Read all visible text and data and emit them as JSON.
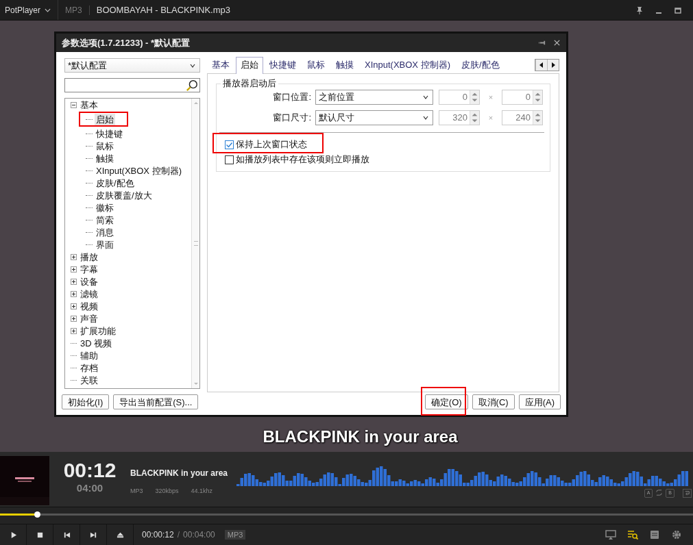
{
  "app_bar": {
    "app_name": "PotPlayer",
    "format": "MP3",
    "file_title": "BOOMBAYAH - BLACKPINK.mp3"
  },
  "subtitle": "BLACKPINK in your area",
  "dialog": {
    "title": "参数选项(1.7.21233) - *默认配置",
    "profile": "*默认配置",
    "tree": [
      {
        "label": "基本",
        "expanded": true,
        "selected": false,
        "children": [
          {
            "label": "启始",
            "selected": true
          },
          {
            "label": "快捷键",
            "selected": false
          },
          {
            "label": "鼠标",
            "selected": false
          },
          {
            "label": "触摸",
            "selected": false
          },
          {
            "label": "XInput(XBOX 控制器)",
            "selected": false
          },
          {
            "label": "皮肤/配色",
            "selected": false
          },
          {
            "label": "皮肤覆盖/放大",
            "selected": false
          },
          {
            "label": "徽标",
            "selected": false
          },
          {
            "label": "简索",
            "selected": false
          },
          {
            "label": "消息",
            "selected": false
          },
          {
            "label": "界面",
            "selected": false
          }
        ]
      },
      {
        "label": "播放",
        "expanded": false,
        "selected": false
      },
      {
        "label": "字幕",
        "expanded": false,
        "selected": false
      },
      {
        "label": "设备",
        "expanded": false,
        "selected": false
      },
      {
        "label": "滤镜",
        "expanded": false,
        "selected": false
      },
      {
        "label": "视频",
        "expanded": false,
        "selected": false
      },
      {
        "label": "声音",
        "expanded": false,
        "selected": false
      },
      {
        "label": "扩展功能",
        "expanded": false,
        "selected": false
      },
      {
        "label": "3D 视频",
        "selected": false
      },
      {
        "label": "辅助",
        "selected": false
      },
      {
        "label": "存档",
        "selected": false
      },
      {
        "label": "关联",
        "selected": false
      }
    ],
    "tabs": [
      {
        "label": "基本",
        "selected": false
      },
      {
        "label": "启始",
        "selected": true
      },
      {
        "label": "快捷键",
        "selected": false
      },
      {
        "label": "鼠标",
        "selected": false
      },
      {
        "label": "触摸",
        "selected": false
      },
      {
        "label": "XInput(XBOX 控制器)",
        "selected": false
      },
      {
        "label": "皮肤/配色",
        "selected": false
      }
    ],
    "group": {
      "title": "播放器启动后",
      "rows": [
        {
          "label": "窗口位置:",
          "value": "之前位置",
          "first": "0",
          "times": "×",
          "second": "0"
        },
        {
          "label": "窗口尺寸:",
          "value": "默认尺寸",
          "first": "320",
          "times": "×",
          "second": "240"
        }
      ]
    },
    "checkboxes": [
      {
        "label": "保持上次窗口状态",
        "checked": true
      },
      {
        "label": "如播放列表中存在该项则立即播放",
        "checked": false
      }
    ],
    "buttons_left": [
      "初始化(I)",
      "导出当前配置(S)..."
    ],
    "buttons_right": [
      "确定(O)",
      "取消(C)",
      "应用(A)"
    ]
  },
  "player": {
    "time": "00:12",
    "duration": "04:00",
    "title": "BLACKPINK in your area",
    "codec": "MP3",
    "bitrate": "320kbps",
    "sample_rate": "44.1khz",
    "ab_buttons": [
      "A",
      "B"
    ],
    "seek": {
      "level": 0.053
    },
    "elapsed": "00:00:12",
    "separator": "/",
    "total": "00:04:00",
    "format_badge": "MP3"
  }
}
